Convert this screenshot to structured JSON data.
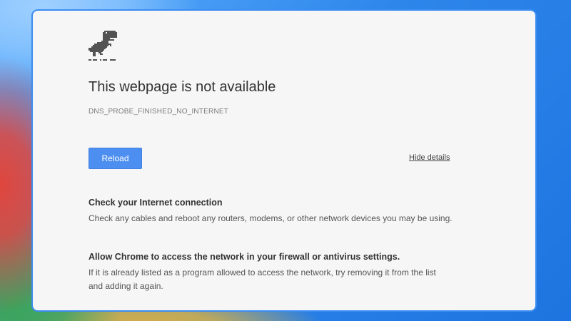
{
  "page": {
    "title": "This webpage is not available",
    "error_code": "DNS_PROBE_FINISHED_NO_INTERNET",
    "icon": "dinosaur-icon"
  },
  "actions": {
    "reload_label": "Reload",
    "hide_details_label": "Hide details"
  },
  "details": {
    "sections": [
      {
        "heading": "Check your Internet connection",
        "body": "Check any cables and reboot any routers, modems, or other network devices you may be using."
      },
      {
        "heading": "Allow Chrome to access the network in your firewall or antivirus settings.",
        "body": "If it is already listed as a program allowed to access the network, try removing it from the list and adding it again."
      }
    ]
  },
  "colors": {
    "button_blue": "#4d8ff0",
    "window_border": "#3b8cf2",
    "page_background": "#f6f6f6",
    "dino": "#535353"
  }
}
